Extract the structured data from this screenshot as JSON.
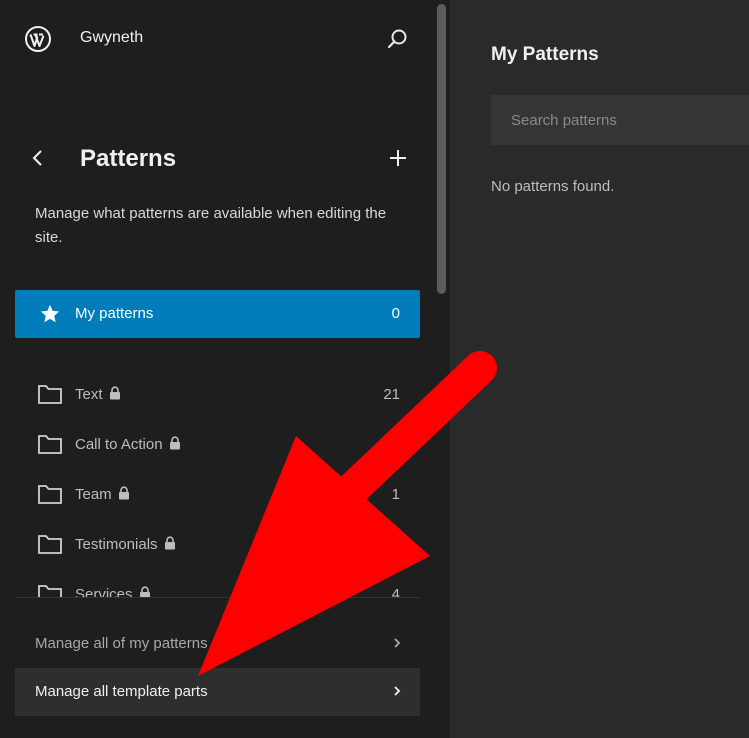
{
  "header": {
    "site_name": "Gwyneth",
    "logo_icon": "wordpress-logo-icon",
    "search_icon": "search-icon"
  },
  "sidebar": {
    "title": "Patterns",
    "back_icon": "chevron-left-icon",
    "add_icon": "plus-icon",
    "description": "Manage what patterns are available when editing the site.",
    "my_patterns": {
      "label": "My patterns",
      "count": "0",
      "icon": "star-icon",
      "color": "#007cba"
    },
    "categories": [
      {
        "label": "Text",
        "count": "21",
        "locked": true
      },
      {
        "label": "Call to Action",
        "count": "1",
        "locked": true
      },
      {
        "label": "Team",
        "count": "1",
        "locked": true
      },
      {
        "label": "Testimonials",
        "count": "8",
        "locked": true
      },
      {
        "label": "Services",
        "count": "4",
        "locked": true
      }
    ],
    "footer": [
      {
        "label": "Manage all of my patterns"
      },
      {
        "label": "Manage all template parts"
      }
    ]
  },
  "main": {
    "title": "My Patterns",
    "search": {
      "placeholder": "Search patterns",
      "value": ""
    },
    "empty_message": "No patterns found."
  },
  "annotation": {
    "type": "red-arrow",
    "color": "#ff0000",
    "points_to": "Manage all template parts"
  }
}
